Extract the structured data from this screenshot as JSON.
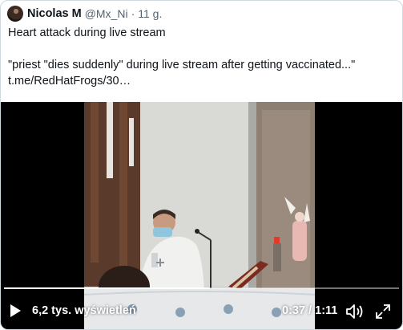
{
  "tweet": {
    "author_name": "Nicolas M",
    "author_handle": "@Mx_Ni",
    "separator": "·",
    "timestamp": "11 g.",
    "line1": "Heart attack during live stream",
    "line2": "\"priest \"dies suddenly\" during live stream after getting vaccinated...\"",
    "link": "t.me/RedHatFrogs/30…"
  },
  "video": {
    "views": "6,2 tys. wyświetleń",
    "current_time": "0:37",
    "time_separator": " / ",
    "duration": "1:11",
    "progress_fraction": 0.5211,
    "icons": [
      "play-icon",
      "volume-icon",
      "fullscreen-icon"
    ]
  },
  "colors": {
    "text_primary": "#0f1419",
    "text_secondary": "#536471",
    "border": "#cfd9de",
    "video_bg": "#000000"
  }
}
